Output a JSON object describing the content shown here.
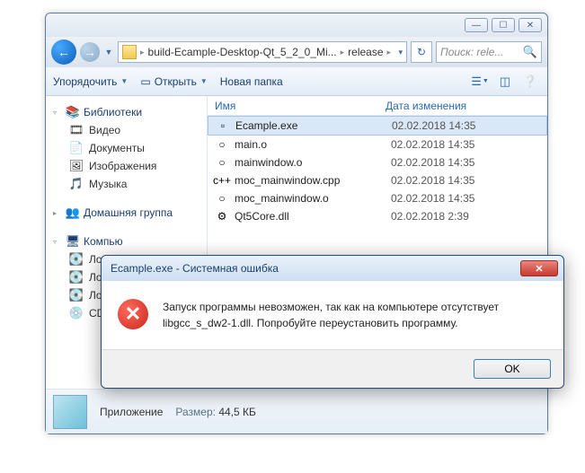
{
  "titlebar": {
    "min": "—",
    "max": "☐",
    "close": "✕"
  },
  "breadcrumb": {
    "part1": "build-Ecample-Desktop-Qt_5_2_0_Mi...",
    "part2": "release",
    "dropdown": "▾"
  },
  "search": {
    "placeholder": "Поиск: rele..."
  },
  "toolbar": {
    "organize": "Упорядочить",
    "open": "Открыть",
    "newfolder": "Новая папка"
  },
  "columns": {
    "name": "Имя",
    "date": "Дата изменения"
  },
  "sidebar": {
    "libraries": {
      "label": "Библиотеки",
      "items": [
        "Видео",
        "Документы",
        "Изображения",
        "Музыка"
      ]
    },
    "homegroup": {
      "label": "Домашняя группа"
    },
    "computer": {
      "label": "Компью",
      "items": [
        "Лока",
        "Лока",
        "Локал",
        "CD-д"
      ]
    }
  },
  "files": [
    {
      "icon": "▫",
      "name": "Ecample.exe",
      "date": "02.02.2018 14:35",
      "sel": true
    },
    {
      "icon": "○",
      "name": "main.o",
      "date": "02.02.2018 14:35"
    },
    {
      "icon": "○",
      "name": "mainwindow.o",
      "date": "02.02.2018 14:35"
    },
    {
      "icon": "c++",
      "name": "moc_mainwindow.cpp",
      "date": "02.02.2018 14:35"
    },
    {
      "icon": "○",
      "name": "moc_mainwindow.o",
      "date": "02.02.2018 14:35"
    },
    {
      "icon": "⚙",
      "name": "Qt5Core.dll",
      "date": "02.02.2018 2:39"
    }
  ],
  "status": {
    "type_label": "Приложение",
    "size_label": "Размер:",
    "size_value": "44,5 КБ"
  },
  "error": {
    "title": "Ecample.exe - Системная ошибка",
    "message": "Запуск программы невозможен, так как на компьютере отсутствует libgcc_s_dw2-1.dll. Попробуйте переустановить программу.",
    "ok": "OK"
  }
}
